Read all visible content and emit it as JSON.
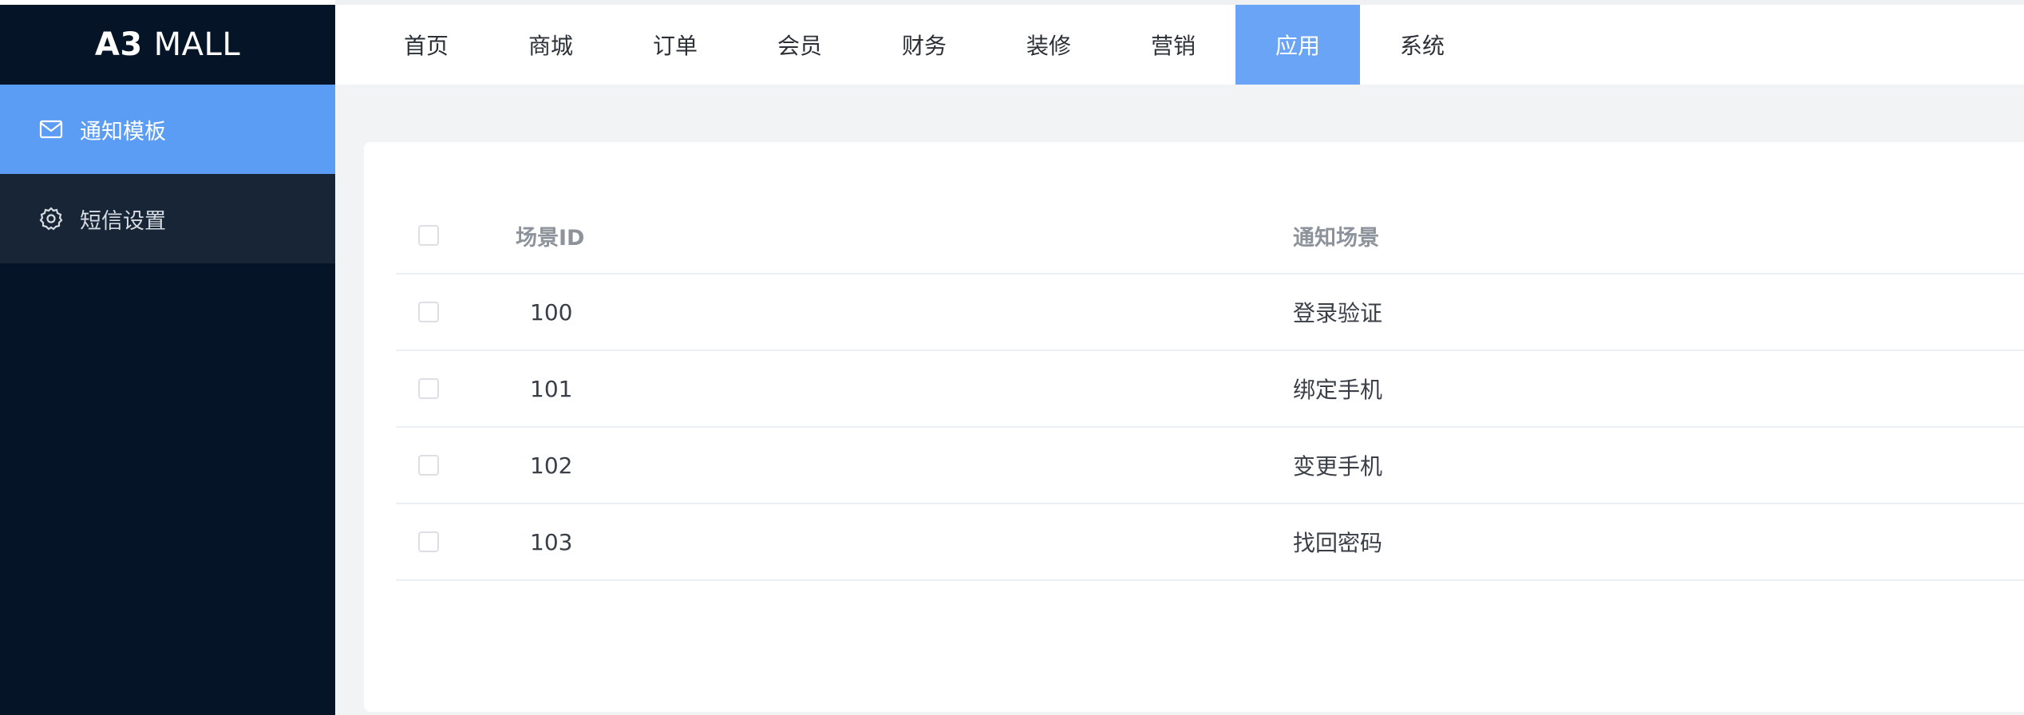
{
  "logo": {
    "bold": "A3",
    "light": "MALL"
  },
  "sidebar": {
    "items": [
      {
        "label": "通知模板",
        "icon": "mail-icon",
        "active": true
      },
      {
        "label": "短信设置",
        "icon": "gear-icon",
        "active": false
      }
    ]
  },
  "topnav": {
    "items": [
      {
        "label": "首页"
      },
      {
        "label": "商城"
      },
      {
        "label": "订单"
      },
      {
        "label": "会员"
      },
      {
        "label": "财务"
      },
      {
        "label": "装修"
      },
      {
        "label": "营销"
      },
      {
        "label": "应用",
        "active": true
      },
      {
        "label": "系统"
      }
    ]
  },
  "table": {
    "columns": {
      "id": "场景ID",
      "scene": "通知场景"
    },
    "rows": [
      {
        "id": "100",
        "scene": "登录验证"
      },
      {
        "id": "101",
        "scene": "绑定手机"
      },
      {
        "id": "102",
        "scene": "变更手机"
      },
      {
        "id": "103",
        "scene": "找回密码"
      }
    ]
  },
  "colors": {
    "sidebar_bg": "#051527",
    "accent": "#5b9cf5",
    "nav_active": "#6aa4f6"
  }
}
